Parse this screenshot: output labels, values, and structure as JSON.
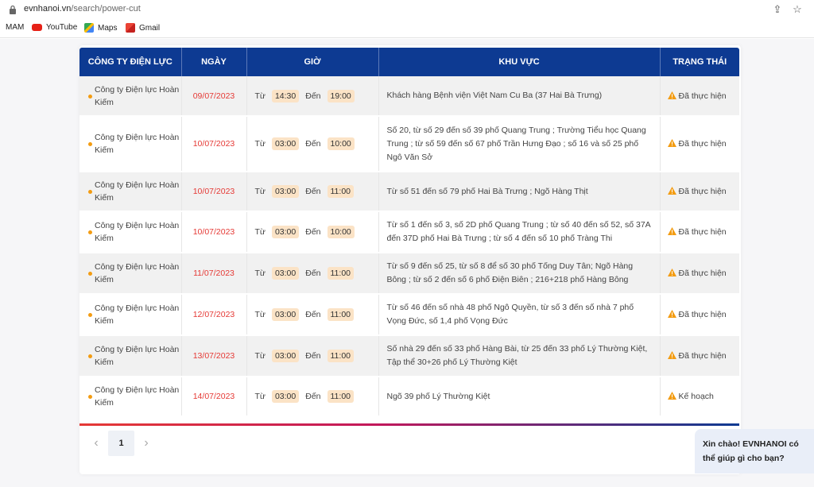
{
  "browser": {
    "url_host": "evnhanoi.vn",
    "url_path": "/search/power-cut",
    "bookmarks": [
      "MAM",
      "YouTube",
      "Maps",
      "Gmail"
    ]
  },
  "table": {
    "headers": [
      "CÔNG TY ĐIỆN LỰC",
      "NGÀY",
      "GIỜ",
      "KHU VỰC",
      "TRẠNG THÁI"
    ],
    "from_label": "Từ",
    "to_label": "Đến",
    "rows": [
      {
        "company": "Công ty Điện lực Hoàn Kiếm",
        "date": "09/07/2023",
        "from": "14:30",
        "to": "19:00",
        "area": "Khách hàng Bệnh viện Việt Nam Cu Ba (37 Hai Bà Trưng)",
        "status": "Đã thực hiện"
      },
      {
        "company": "Công ty Điện lực Hoàn Kiếm",
        "date": "10/07/2023",
        "from": "03:00",
        "to": "10:00",
        "area": "Số 20, từ số 29 đến số 39 phố Quang Trung ; Trường Tiểu học Quang Trung ; từ số 59 đến số 67 phố Trần Hưng Đạo ; số 16 và số 25 phố Ngô Văn Sở",
        "status": "Đã thực hiện"
      },
      {
        "company": "Công ty Điện lực Hoàn Kiếm",
        "date": "10/07/2023",
        "from": "03:00",
        "to": "11:00",
        "area": "Từ số 51 đến số 79 phố Hai Bà Trưng ; Ngõ Hàng Thịt",
        "status": "Đã thực hiện"
      },
      {
        "company": "Công ty Điện lực Hoàn Kiếm",
        "date": "10/07/2023",
        "from": "03:00",
        "to": "10:00",
        "area": "Từ số 1 đến số 3, số 2D phố Quang Trung ; từ số 40 đến số 52, số 37A đến 37D phố Hai Bà Trưng ; từ số 4 đến số 10 phố Tràng Thi",
        "status": "Đã thực hiện"
      },
      {
        "company": "Công ty Điện lực Hoàn Kiếm",
        "date": "11/07/2023",
        "from": "03:00",
        "to": "11:00",
        "area": "Từ số 9 đến số 25, từ số 8 để số 30 phố Tống Duy Tân; Ngõ Hàng Bông ; từ số 2 đến số 6 phố Điện Biên ; 216+218 phố Hàng Bông",
        "status": "Đã thực hiện"
      },
      {
        "company": "Công ty Điện lực Hoàn Kiếm",
        "date": "12/07/2023",
        "from": "03:00",
        "to": "11:00",
        "area": "Từ số 46 đến số nhà 48 phố Ngô Quyền, từ số 3 đến số nhà 7 phố Vọng Đức, số 1,4 phố Vọng Đức",
        "status": "Đã thực hiện"
      },
      {
        "company": "Công ty Điện lực Hoàn Kiếm",
        "date": "13/07/2023",
        "from": "03:00",
        "to": "11:00",
        "area": "Số nhà 29 đến số 33 phố Hàng Bài, từ 25 đến 33 phố Lý Thường Kiệt, Tập thể 30+26 phố Lý Thường Kiệt",
        "status": "Đã thực hiện"
      },
      {
        "company": "Công ty Điện lực Hoàn Kiếm",
        "date": "14/07/2023",
        "from": "03:00",
        "to": "11:00",
        "area": "Ngõ 39 phố Lý Thường Kiệt",
        "status": "Kế hoạch"
      }
    ]
  },
  "pagination": {
    "current": "1"
  },
  "chat": {
    "text": "Xin chào! EVNHANOI có thể giúp gì cho bạn?"
  }
}
